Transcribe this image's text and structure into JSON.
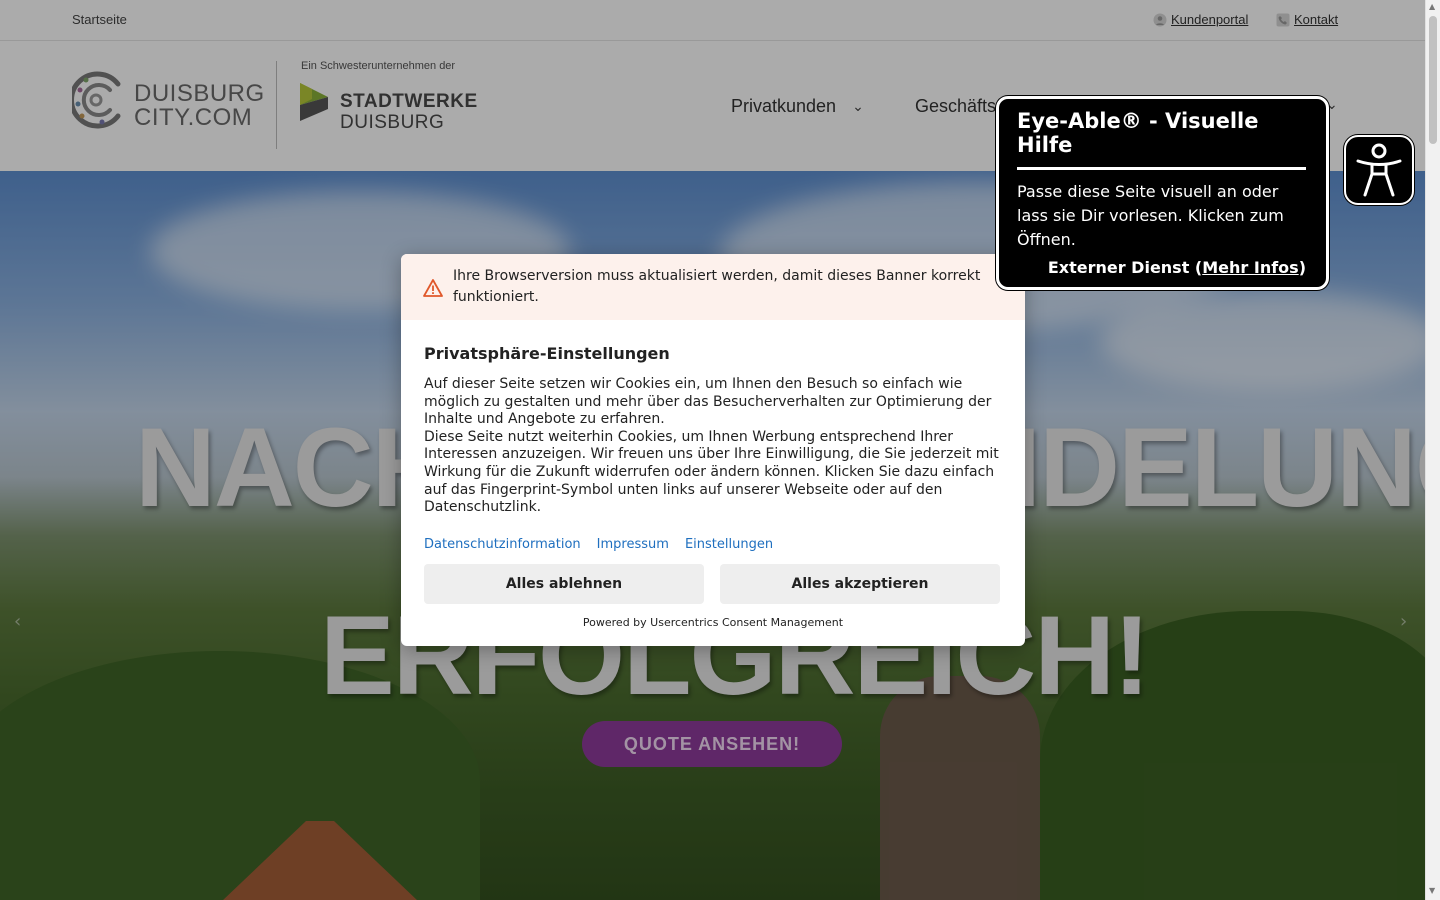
{
  "topbar": {
    "home": "Startseite",
    "customer_portal": "Kundenportal",
    "contact": "Kontakt"
  },
  "header": {
    "logo_duisburg_line1": "DUISBURG",
    "logo_duisburg_line2": "CITY.COM",
    "sister_caption": "Ein Schwesterunternehmen der",
    "logo_sw_line1": "STADTWERKE",
    "logo_sw_line2": "DUISBURG",
    "nav": [
      {
        "label": "Privatkunden"
      },
      {
        "label": "Geschäfts"
      }
    ]
  },
  "hero": {
    "headline_line1_left": "NACH",
    "headline_line1_right": "IDELUNG",
    "headline_line2": "ERFOLGREICH!",
    "cta": "QUOTE ANSEHEN!"
  },
  "consent": {
    "warning": "Ihre Browserversion muss aktualisiert werden, damit dieses Banner korrekt funktioniert.",
    "title": "Privatsphäre-Einstellungen",
    "paragraph1": "Auf dieser Seite setzen wir Cookies ein, um Ihnen den Besuch so einfach wie möglich zu gestalten und mehr über das Besucherverhalten zur Optimierung der Inhalte und Angebote zu erfahren.",
    "paragraph2": "Diese Seite nutzt weiterhin Cookies, um Ihnen Werbung entsprechend Ihrer Interessen anzuzeigen. Wir freuen uns über Ihre Einwilligung, die Sie jederzeit mit Wirkung für die Zukunft widerrufen oder ändern können. Klicken Sie dazu einfach auf das Fingerprint-Symbol unten links auf unserer Webseite oder auf den Datenschutzlink.",
    "links": {
      "privacy": "Datenschutzinformation",
      "imprint": "Impressum",
      "settings": "Einstellungen"
    },
    "deny_all": "Alles ablehnen",
    "accept_all": "Alles akzeptieren",
    "powered_by": "Powered by Usercentrics Consent Management"
  },
  "eye_able": {
    "title": "Eye-Able® - Visuelle Hilfe",
    "description": "Passe diese Seite visuell an oder lass sie Dir vorlesen. Klicken zum Öffnen.",
    "external_prefix": "Externer Dienst (",
    "more_info": "Mehr Infos",
    "external_suffix": ")"
  },
  "colors": {
    "cta": "#8e3b9c",
    "link": "#1f6fbf",
    "warning_bg": "#fdf1ec",
    "warning_icon": "#e0582b"
  }
}
